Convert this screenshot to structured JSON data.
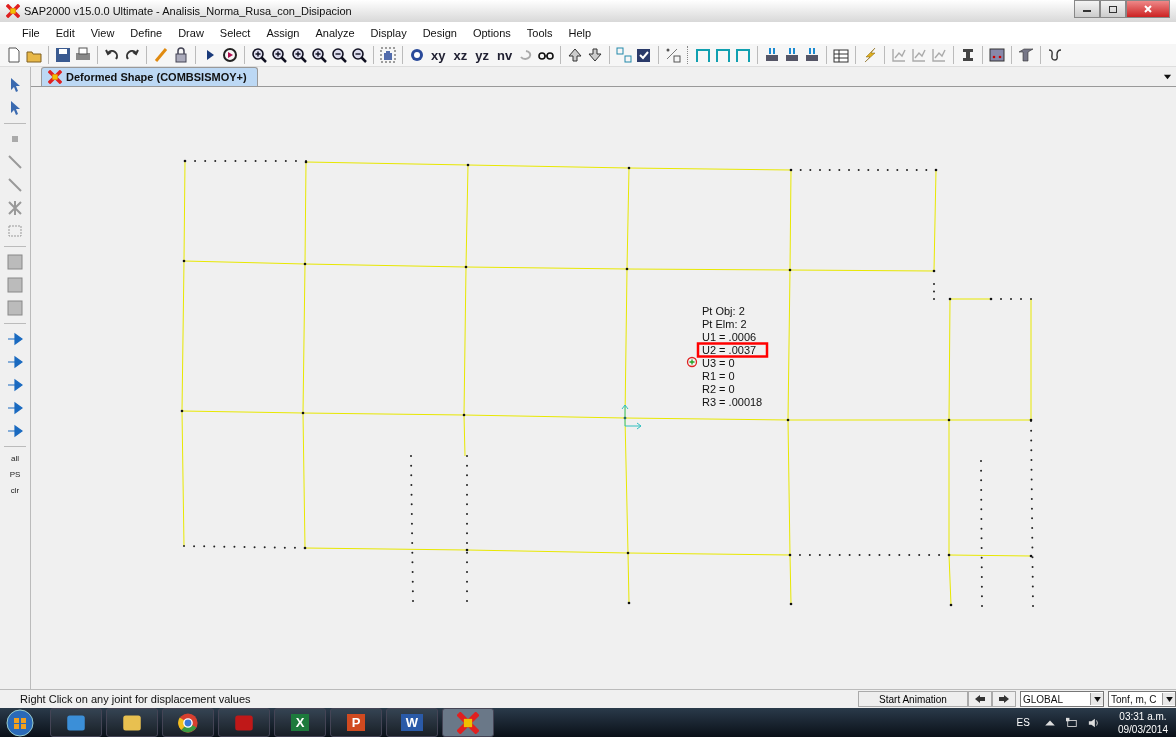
{
  "window": {
    "title": "SAP2000 v15.0.0 Ultimate  - Analisis_Norma_Rusa_con_Disipacion"
  },
  "menu": [
    "File",
    "Edit",
    "View",
    "Define",
    "Draw",
    "Select",
    "Assign",
    "Analyze",
    "Display",
    "Design",
    "Options",
    "Tools",
    "Help"
  ],
  "toolbar": {
    "view_buttons": [
      "xy",
      "xz",
      "yz",
      "nv"
    ]
  },
  "tabs": [
    {
      "label": "Deformed Shape (COMBSISMOY+)",
      "selected": true
    }
  ],
  "side_tools": {
    "text_tools": [
      "all",
      "PS",
      "clr"
    ]
  },
  "tooltip": {
    "lines": [
      {
        "text": "Pt Obj: 2",
        "highlighted": false
      },
      {
        "text": "Pt Elm: 2",
        "highlighted": false
      },
      {
        "text": "U1 =  .0006",
        "highlighted": false
      },
      {
        "text": "U2 =  .0037",
        "highlighted": true
      },
      {
        "text": "U3 =  0",
        "highlighted": false
      },
      {
        "text": "R1 =  0",
        "highlighted": false
      },
      {
        "text": "R2 =  0",
        "highlighted": false
      },
      {
        "text": "R3 =  .00018",
        "highlighted": false
      }
    ]
  },
  "status_bar": {
    "message": "Right Click on any joint for displacement values",
    "animation_button": "Start Animation",
    "coordinate_system": "GLOBAL",
    "units": "Tonf, m, C"
  },
  "taskbar": {
    "apps": [
      {
        "kind": "media"
      },
      {
        "kind": "explorer"
      },
      {
        "kind": "browser"
      },
      {
        "kind": "pdf"
      },
      {
        "kind": "sheet",
        "glyph": "X"
      },
      {
        "kind": "slides",
        "glyph": "P"
      },
      {
        "kind": "doc",
        "glyph": "W"
      },
      {
        "kind": "sap",
        "active": true
      }
    ],
    "language": "ES",
    "time": "03:31 a.m.",
    "date": "09/03/2014"
  }
}
